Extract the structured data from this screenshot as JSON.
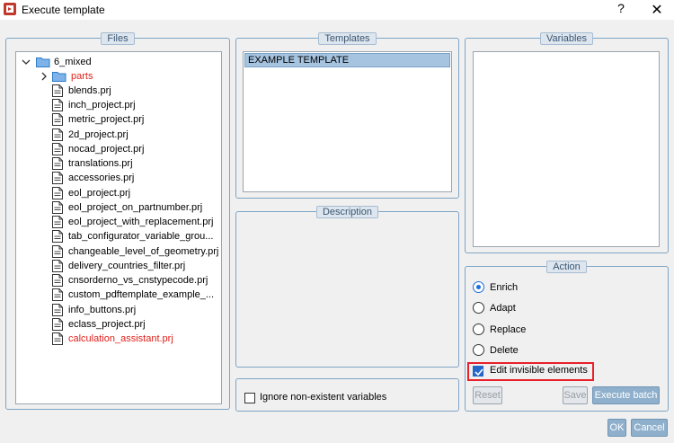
{
  "window": {
    "title": "Execute template",
    "help_label": "?",
    "close_label": "✕"
  },
  "files": {
    "title": "Files",
    "root": "6_mixed",
    "folder": "parts",
    "items": [
      {
        "label": "blends.prj",
        "color": ""
      },
      {
        "label": "inch_project.prj",
        "color": ""
      },
      {
        "label": "metric_project.prj",
        "color": ""
      },
      {
        "label": "2d_project.prj",
        "color": ""
      },
      {
        "label": "nocad_project.prj",
        "color": ""
      },
      {
        "label": "translations.prj",
        "color": ""
      },
      {
        "label": "accessories.prj",
        "color": ""
      },
      {
        "label": "eol_project.prj",
        "color": ""
      },
      {
        "label": "eol_project_on_partnumber.prj",
        "color": ""
      },
      {
        "label": "eol_project_with_replacement.prj",
        "color": ""
      },
      {
        "label": "tab_configurator_variable_grou...",
        "color": ""
      },
      {
        "label": "changeable_level_of_geometry.prj",
        "color": ""
      },
      {
        "label": "delivery_countries_filter.prj",
        "color": ""
      },
      {
        "label": "cnsorderno_vs_cnstypecode.prj",
        "color": ""
      },
      {
        "label": "custom_pdftemplate_example_...",
        "color": ""
      },
      {
        "label": "info_buttons.prj",
        "color": ""
      },
      {
        "label": "eclass_project.prj",
        "color": ""
      },
      {
        "label": "calculation_assistant.prj",
        "color": "#e0211b"
      }
    ]
  },
  "templates": {
    "title": "Templates",
    "items": [
      "EXAMPLE TEMPLATE"
    ]
  },
  "description": {
    "title": "Description"
  },
  "ignore": {
    "label": "Ignore non-existent variables",
    "checked": false
  },
  "variables": {
    "title": "Variables"
  },
  "action": {
    "title": "Action",
    "options": [
      {
        "label": "Enrich",
        "selected": true
      },
      {
        "label": "Adapt",
        "selected": false
      },
      {
        "label": "Replace",
        "selected": false
      },
      {
        "label": "Delete",
        "selected": false
      }
    ],
    "edit_invisible_label": "Edit invisible elements",
    "edit_invisible_checked": true,
    "reset_label": "Reset",
    "save_label": "Save",
    "execute_label": "Execute batch"
  },
  "footer": {
    "ok_label": "OK",
    "cancel_label": "Cancel"
  }
}
